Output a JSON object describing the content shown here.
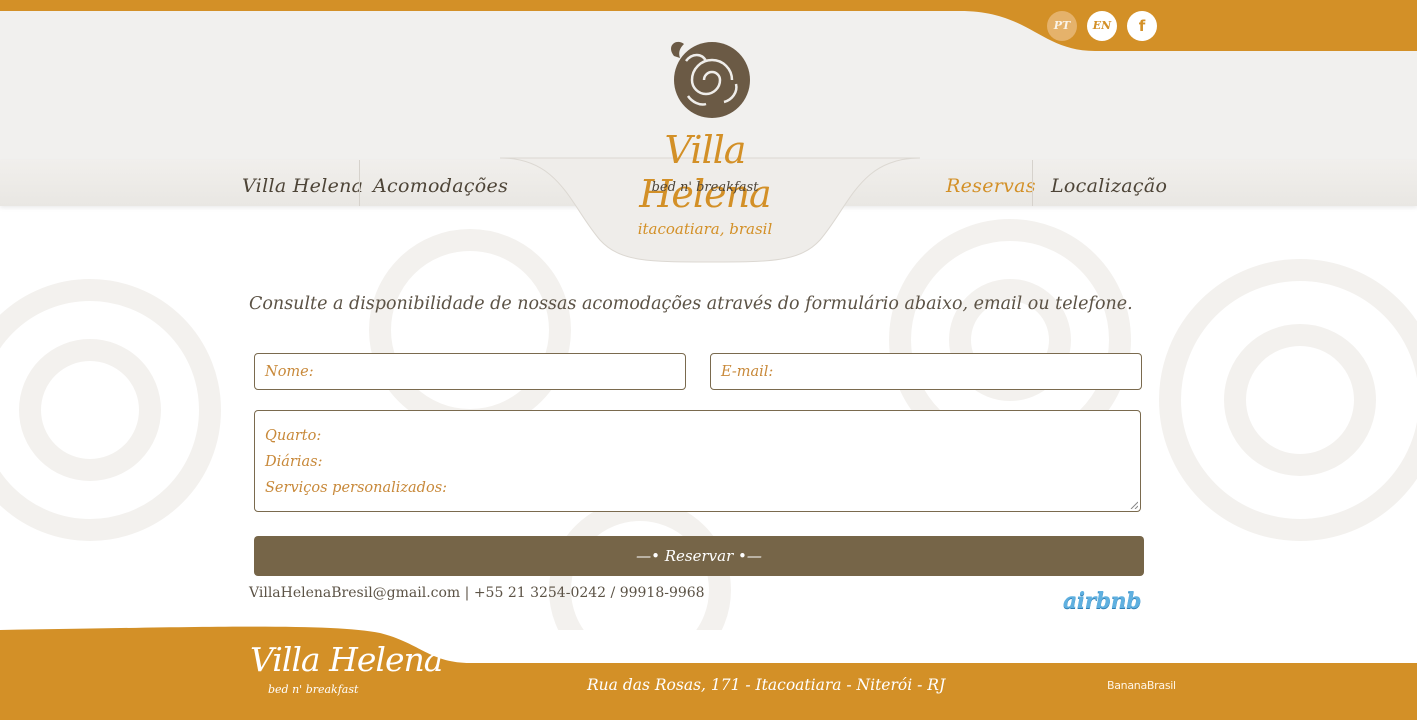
{
  "colors": {
    "brand_orange": "#d39027",
    "dark_brown": "#766548",
    "text_brown": "#4d4437",
    "header_gray": "#f1f0ee"
  },
  "header": {
    "languages": [
      {
        "label": "PT",
        "active": true
      },
      {
        "label": "EN",
        "active": false
      }
    ],
    "facebook_label": "f",
    "nav_left": [
      "Villa Helena",
      "Acomodações"
    ],
    "nav_right": [
      "Reservas",
      "Localização"
    ],
    "active_nav": "Reservas"
  },
  "logo": {
    "title": "Villa Helena",
    "subtitle": "bed n' breakfast",
    "place": "itacoatiara, brasil"
  },
  "main": {
    "intro": "Consulte a disponibilidade de nossas acomodações através do formulário abaixo, email ou telefone.",
    "form": {
      "name_placeholder": "Nome:",
      "email_placeholder": "E-mail:",
      "message_lines": [
        "Quarto:",
        "Diárias:",
        "Serviços personalizados:"
      ],
      "submit_label": "—• Reservar •—"
    },
    "contact": {
      "email": "VillaHelenaBresil@gmail.com",
      "separator": " | ",
      "phones": "+55 21 3254-0242 / 99918-9968"
    },
    "airbnb_label": "airbnb"
  },
  "footer": {
    "logo_title": "Villa Helena",
    "logo_subtitle": "bed n' breakfast",
    "address": "Rua das Rosas, 171 - Itacoatiara - Niterói - RJ",
    "credit": "BananaBrasil"
  }
}
